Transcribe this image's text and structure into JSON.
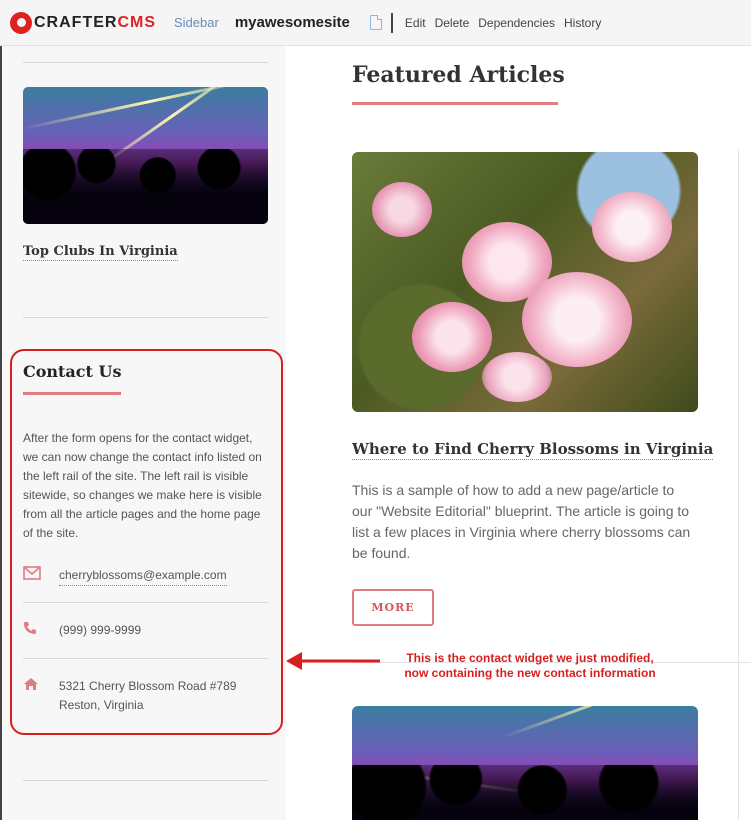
{
  "topbar": {
    "logo_main": "CRAFTER",
    "logo_accent": "CMS",
    "sidebar_label": "Sidebar",
    "site_name": "myawesomesite",
    "menu": [
      "Edit",
      "Delete",
      "Dependencies",
      "History"
    ]
  },
  "sidebar": {
    "club_title": "Top Clubs In Virginia",
    "contact": {
      "heading": "Contact Us",
      "text": "After the form opens for the contact widget, we can now change the contact info listed on the left rail of the site.  The left rail is visible sitewide, so changes we make here is visible from all the article pages and the home page of the site.",
      "email": "cherryblossoms@example.com",
      "phone": "(999) 999-9999",
      "address_line1": "5321 Cherry Blossom Road #789",
      "address_line2": "Reston, Virginia"
    }
  },
  "main": {
    "title": "Featured Articles",
    "article_title": "Where to Find Cherry Blossoms in Virginia",
    "article_desc": "This is a sample of how to add a new page/article to our \"Website Editorial\" blueprint. The article is going to list a few places in Virginia where cherry blossoms can be found.",
    "more_label": "MORE"
  },
  "annotation": {
    "line1": "This is the contact widget we just modified,",
    "line2": "now containing the new contact information"
  },
  "colors": {
    "accent": "#e07c82",
    "annotation": "#d71f1f",
    "brand_red": "#dd2222"
  },
  "icons": [
    "envelope-icon",
    "phone-icon",
    "home-icon",
    "page-icon"
  ]
}
